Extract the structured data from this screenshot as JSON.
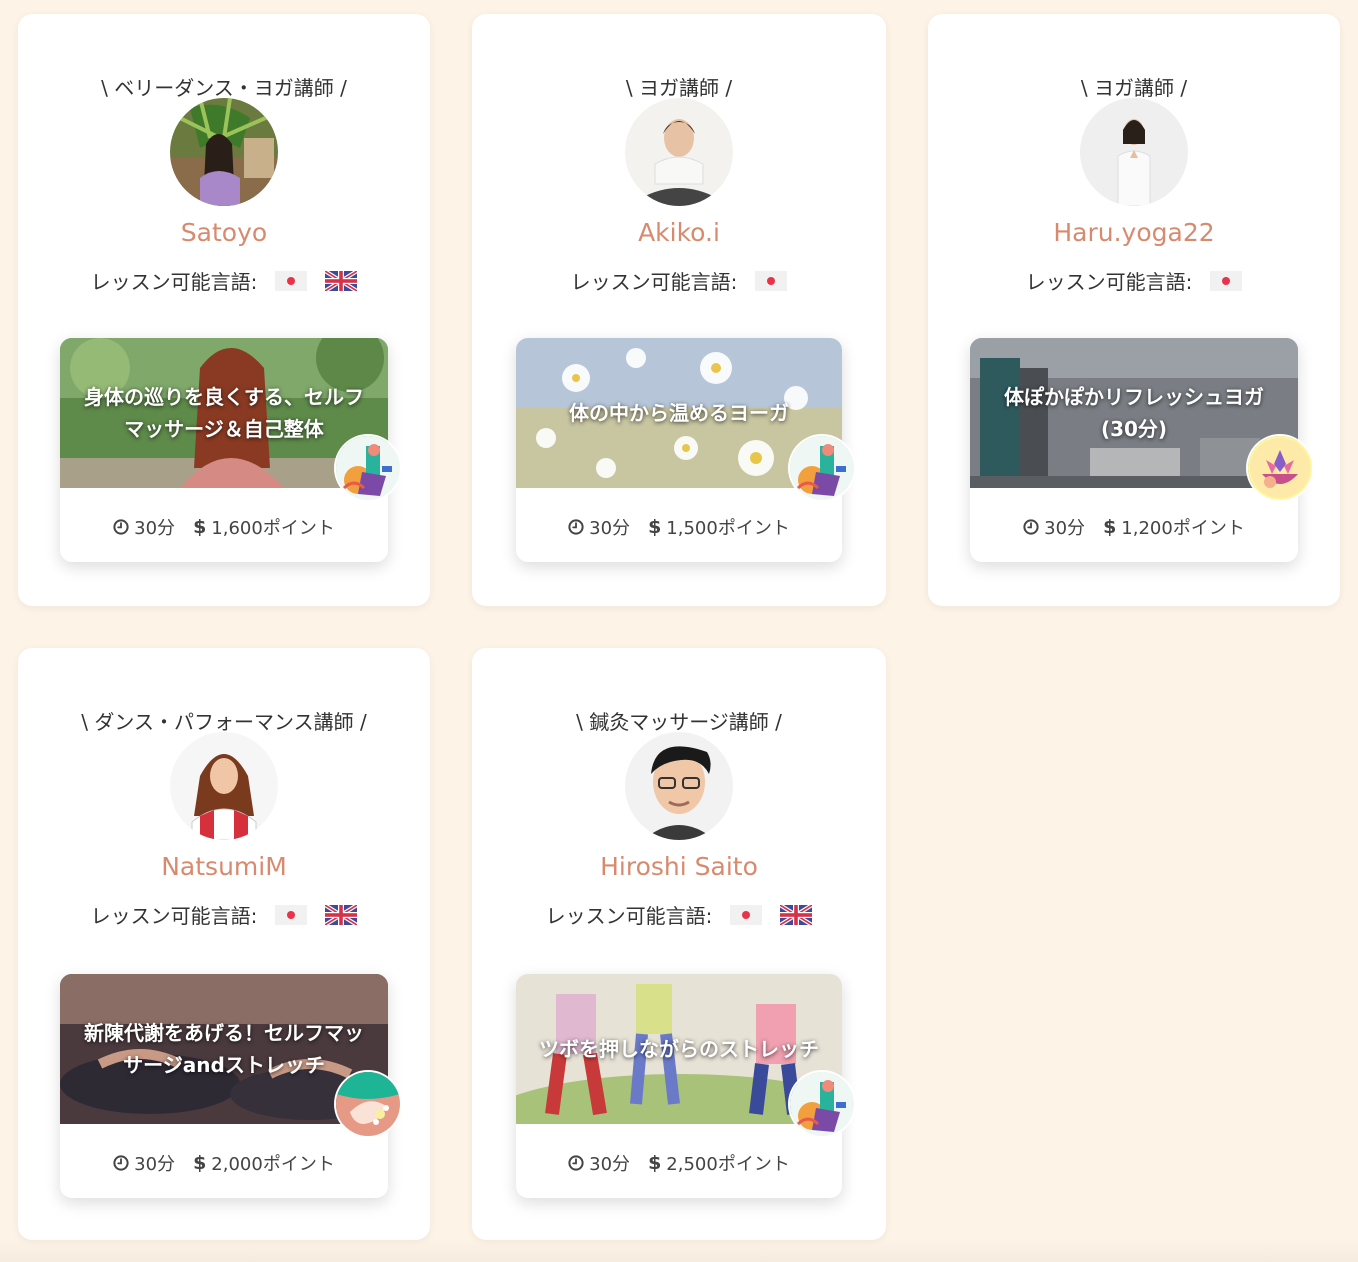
{
  "instructors": [
    {
      "role": "\\ ベリーダンス・ヨガ講師 /",
      "name": "Satoyo",
      "languages_label": "レッスン可能言語:",
      "languages": [
        "japan-flag-icon",
        "uk-flag-icon"
      ],
      "lesson": {
        "title": "身体の巡りを良くする、セルフマッサージ＆自己整体",
        "duration": "30分",
        "price": "1,600ポイント"
      }
    },
    {
      "role": "\\ ヨガ講師 /",
      "name": "Akiko.i",
      "languages_label": "レッスン可能言語:",
      "languages": [
        "japan-flag-icon"
      ],
      "lesson": {
        "title": "体の中から温めるヨーガ",
        "duration": "30分",
        "price": "1,500ポイント"
      }
    },
    {
      "role": "\\ ヨガ講師 /",
      "name": "Haru.yoga22",
      "languages_label": "レッスン可能言語:",
      "languages": [
        "japan-flag-icon"
      ],
      "lesson": {
        "title": "体ぽかぽかリフレッシュヨガ(30分)",
        "duration": "30分",
        "price": "1,200ポイント"
      }
    },
    {
      "role": "\\ ダンス・パフォーマンス講師 /",
      "name": "NatsumiM",
      "languages_label": "レッスン可能言語:",
      "languages": [
        "japan-flag-icon",
        "uk-flag-icon"
      ],
      "lesson": {
        "title": "新陳代謝をあげる！セルフマッサージandストレッチ",
        "duration": "30分",
        "price": "2,000ポイント"
      }
    },
    {
      "role": "\\ 鍼灸マッサージ講師 /",
      "name": "Hiroshi Saito",
      "languages_label": "レッスン可能言語:",
      "languages": [
        "japan-flag-icon",
        "uk-flag-icon"
      ],
      "lesson": {
        "title": "ツボを押しながらのストレッチ",
        "duration": "30分",
        "price": "2,500ポイント"
      }
    }
  ],
  "icons": {
    "duration": "clock-icon",
    "price": "dollar-icon",
    "price_symbol": "$"
  },
  "colors": {
    "page_background": "#fdf3e6",
    "instructor_name": "#d88a6e",
    "card_background": "#ffffff"
  }
}
